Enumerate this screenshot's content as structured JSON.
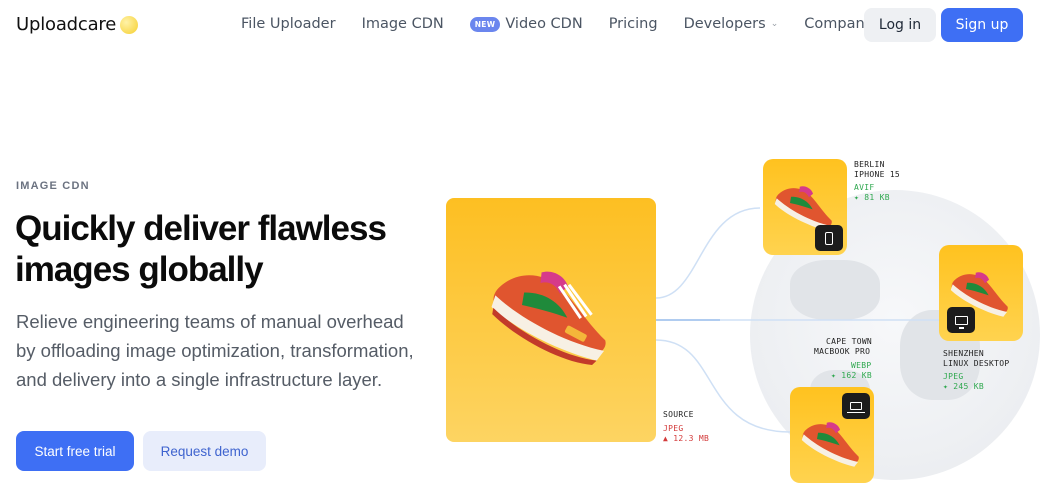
{
  "nav": {
    "logo": "Uploadcare",
    "links": [
      {
        "label": "File Uploader",
        "badge": "",
        "dropdown": false
      },
      {
        "label": "Image CDN",
        "badge": "",
        "dropdown": false
      },
      {
        "label": "Video CDN",
        "badge": "NEW",
        "dropdown": false
      },
      {
        "label": "Pricing",
        "badge": "",
        "dropdown": false
      },
      {
        "label": "Developers",
        "badge": "",
        "dropdown": true
      },
      {
        "label": "Company",
        "badge": "",
        "dropdown": true
      }
    ],
    "login": "Log in",
    "signup": "Sign up"
  },
  "hero": {
    "eyebrow": "IMAGE CDN",
    "headline_line1": "Quickly deliver flawless",
    "headline_line2": "images globally",
    "subtitle": "Relieve engineering teams of manual overhead by offloading image optimization, transformation, and delivery into a single infrastructure layer.",
    "cta_primary": "Start free trial",
    "cta_secondary": "Request demo"
  },
  "visual": {
    "source": {
      "label": "SOURCE",
      "format": "JPEG",
      "size": "12.3 MB"
    },
    "outputs": {
      "berlin": {
        "city": "BERLIN",
        "device": "IPHONE 15",
        "format": "AVIF",
        "size": "81 KB",
        "icon": "phone-icon"
      },
      "cape": {
        "city": "CAPE TOWN",
        "device": "MACBOOK PRO",
        "format": "WEBP",
        "size": "162 KB",
        "icon": "laptop-icon"
      },
      "shenzhen": {
        "city": "SHENZHEN",
        "device": "LINUX DESKTOP",
        "format": "JPEG",
        "size": "245 KB",
        "icon": "monitor-icon"
      }
    },
    "colors": {
      "accent": "#3e6ff4",
      "card": "#ffc21f",
      "green": "#2fa84f",
      "red": "#d33a3a"
    }
  }
}
